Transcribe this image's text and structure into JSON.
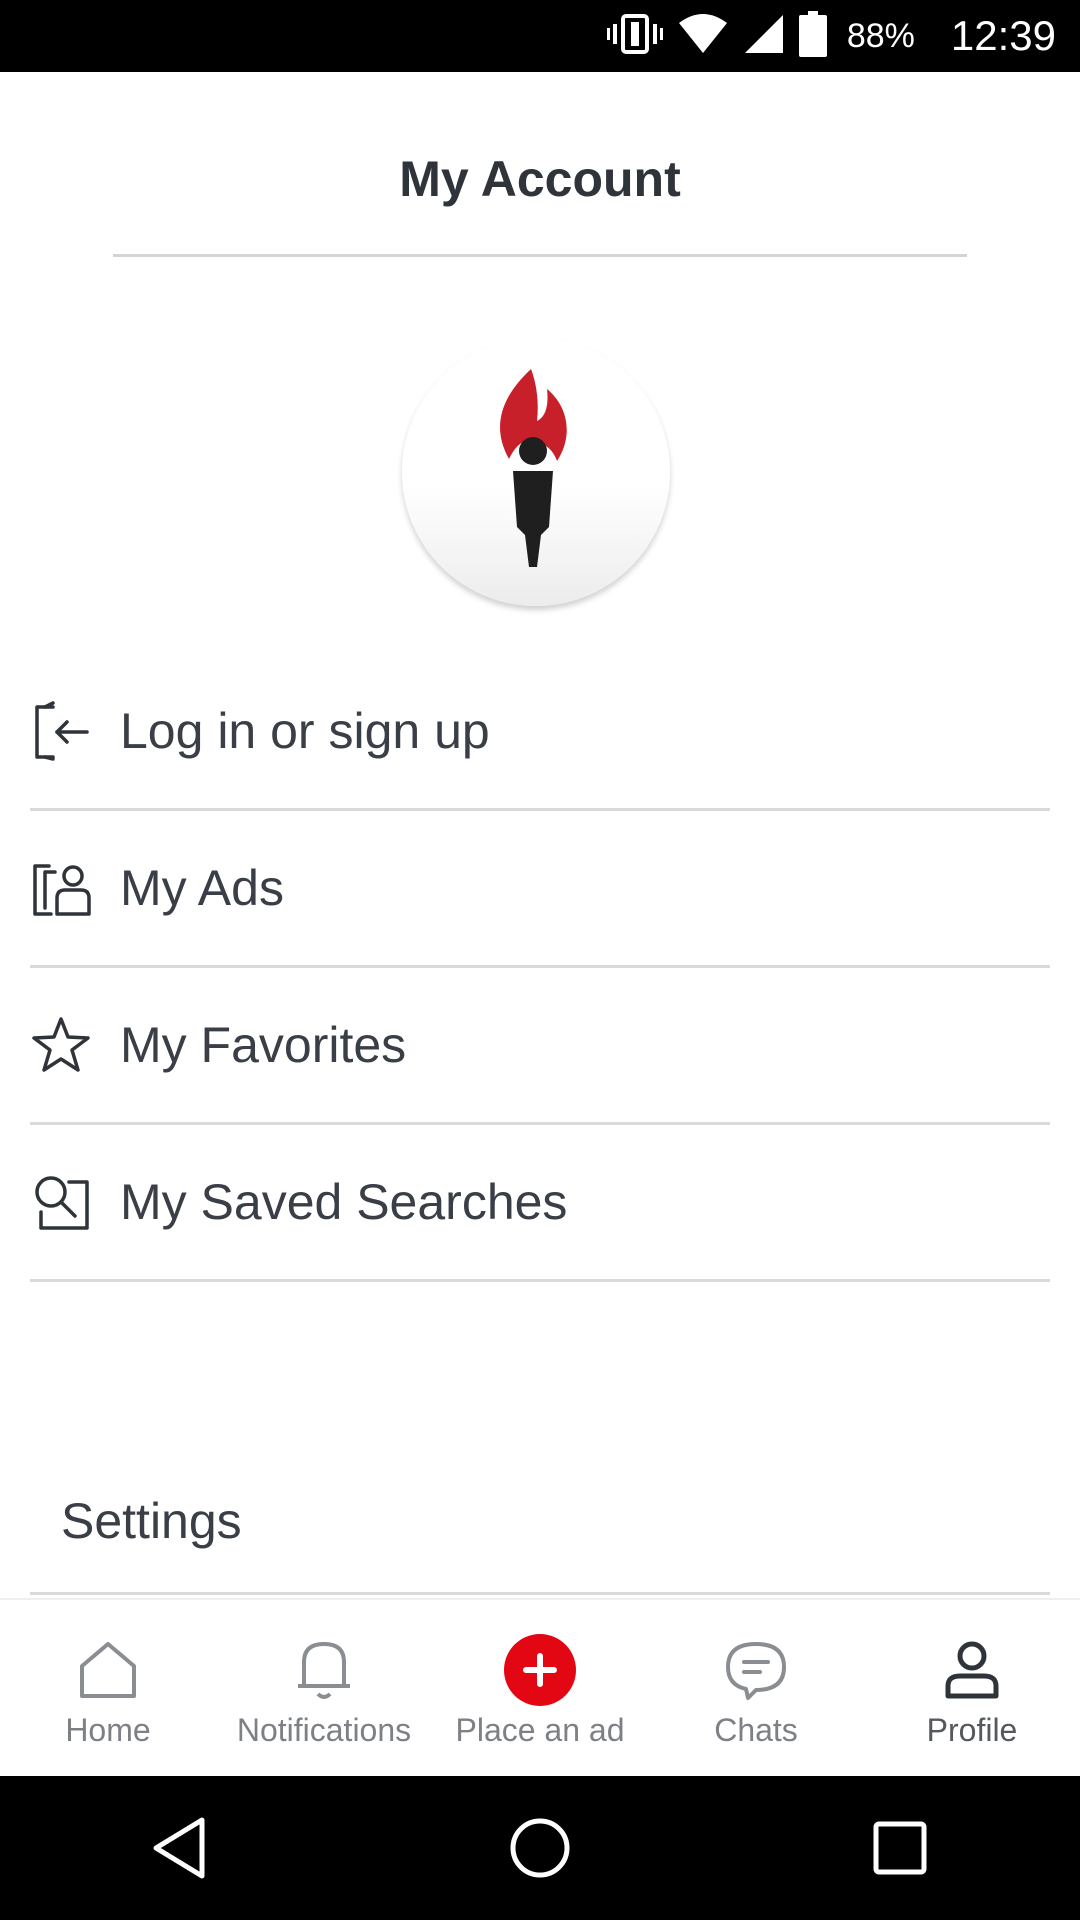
{
  "status_bar": {
    "battery_percent": "88%",
    "time": "12:39",
    "icons": [
      "vibrate-icon",
      "wifi-icon",
      "signal-icon",
      "battery-icon"
    ]
  },
  "header": {
    "title": "My Account"
  },
  "logo": {
    "name": "torch-logo"
  },
  "menu": {
    "items": [
      {
        "label": "Log in or sign up",
        "icon": "login-icon"
      },
      {
        "label": "My Ads",
        "icon": "my-ads-icon"
      },
      {
        "label": "My Favorites",
        "icon": "star-icon"
      },
      {
        "label": "My Saved Searches",
        "icon": "saved-search-icon"
      }
    ],
    "settings_label": "Settings"
  },
  "bottom_nav": {
    "items": [
      {
        "label": "Home",
        "icon": "home-icon"
      },
      {
        "label": "Notifications",
        "icon": "bell-icon"
      },
      {
        "label": "Place an ad",
        "icon": "plus-circle-icon"
      },
      {
        "label": "Chats",
        "icon": "chat-icon"
      },
      {
        "label": "Profile",
        "icon": "profile-icon"
      }
    ],
    "active": "Profile"
  },
  "colors": {
    "accent": "#e30613",
    "text": "#3a3f47",
    "divider": "#dadada"
  }
}
